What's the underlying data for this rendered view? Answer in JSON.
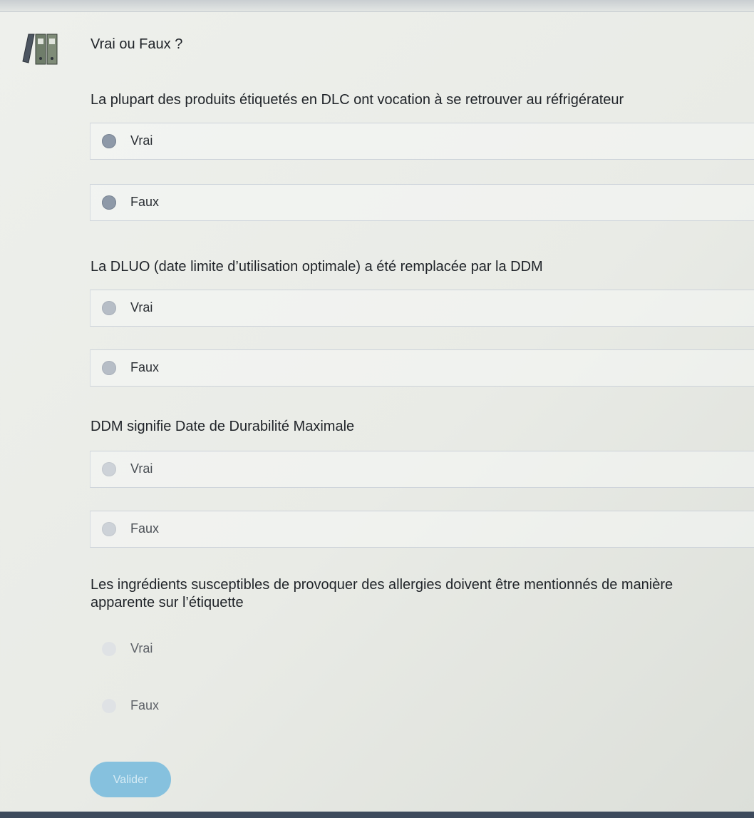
{
  "quiz": {
    "title": "Vrai ou Faux ?"
  },
  "questions": [
    {
      "text": "La plupart des produits étiquetés en DLC ont vocation à se retrouver au réfrigérateur",
      "options": [
        "Vrai",
        "Faux"
      ]
    },
    {
      "text": "La DLUO (date limite d’utilisation optimale) a été remplacée par la DDM",
      "options": [
        "Vrai",
        "Faux"
      ]
    },
    {
      "text": "DDM signifie Date de Durabilité Maximale",
      "options": [
        "Vrai",
        "Faux"
      ]
    },
    {
      "text": "Les ingrédients susceptibles de provoquer des allergies doivent être mentionnés de manière apparente sur l’étiquette",
      "options": [
        "Vrai",
        "Faux"
      ]
    }
  ],
  "actions": {
    "validate_label": "Valider"
  },
  "icons": {
    "app": "binders-icon",
    "radio": "radio-unselected-icon"
  },
  "colors": {
    "accent": "#86c1de",
    "radio": "#8e99a8"
  }
}
